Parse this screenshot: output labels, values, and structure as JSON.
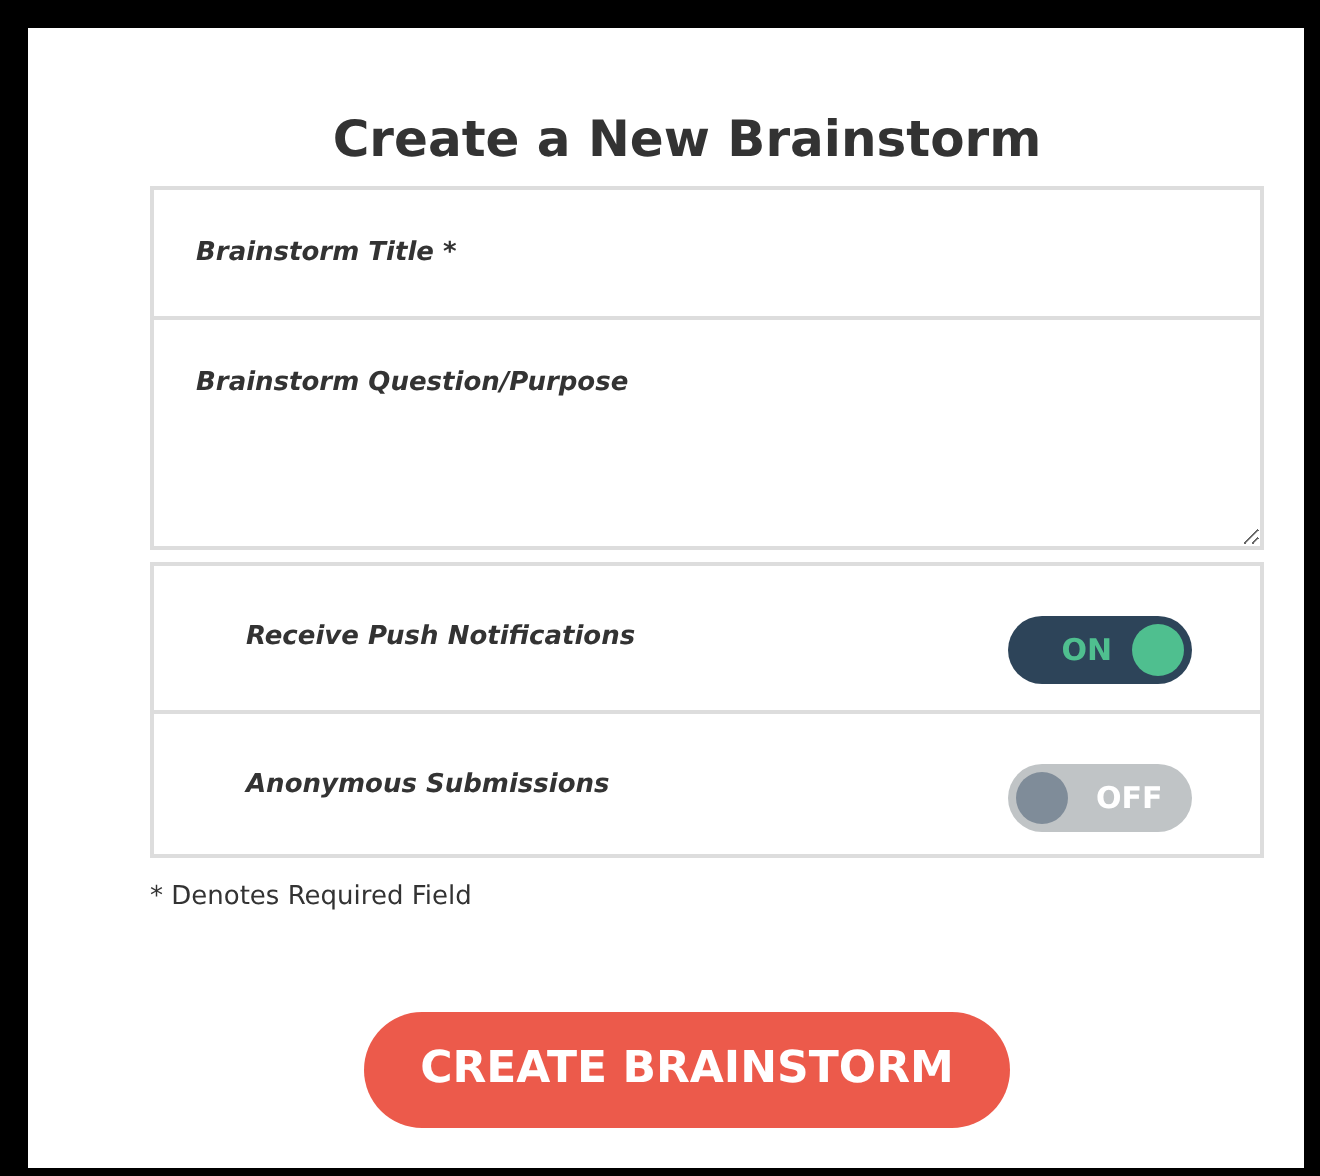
{
  "title": "Create a New Brainstorm",
  "fields": [
    {
      "kind": "input",
      "placeholder": "Brainstorm Title *"
    },
    {
      "kind": "textarea",
      "placeholder": "Brainstorm Question/Purpose"
    }
  ],
  "settings": [
    {
      "label": "Receive Push Notifications",
      "on": true,
      "state_label": "ON"
    },
    {
      "label": "Anonymous Submissions",
      "on": false,
      "state_label": "OFF"
    }
  ],
  "note": "* Denotes Required Field",
  "button": "CREATE BRAINSTORM"
}
